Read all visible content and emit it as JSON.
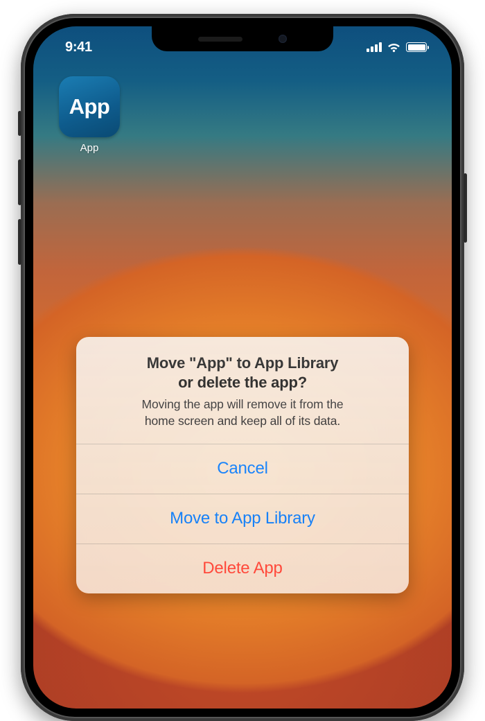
{
  "status": {
    "time": "9:41"
  },
  "home": {
    "app_icon_text": "App",
    "app_label": "App"
  },
  "sheet": {
    "title_line1": "Move \"App\" to App Library",
    "title_line2": "or delete the app?",
    "subtitle_line1": "Moving the app will remove it from the",
    "subtitle_line2": "home screen and keep all of its data.",
    "cancel": "Cancel",
    "move": "Move to App Library",
    "delete": "Delete App"
  },
  "colors": {
    "ios_blue": "#007aff",
    "ios_red": "#ff3b30"
  }
}
